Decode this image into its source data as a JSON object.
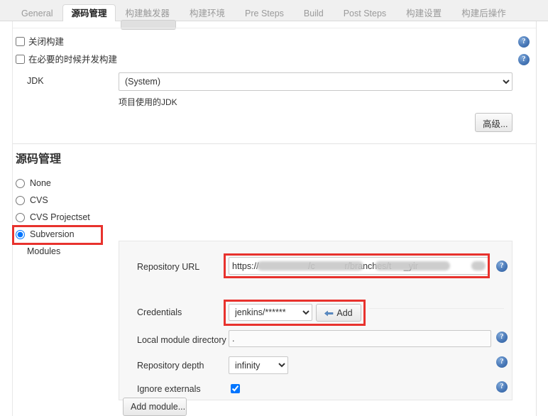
{
  "tabs": [
    {
      "label": "General",
      "active": false
    },
    {
      "label": "源码管理",
      "active": true
    },
    {
      "label": "构建触发器",
      "active": false
    },
    {
      "label": "构建环境",
      "active": false
    },
    {
      "label": "Pre Steps",
      "active": false
    },
    {
      "label": "Build",
      "active": false
    },
    {
      "label": "Post Steps",
      "active": false
    },
    {
      "label": "构建设置",
      "active": false
    },
    {
      "label": "构建后操作",
      "active": false
    }
  ],
  "general": {
    "disable_build_label": "关闭构建",
    "disable_build_checked": false,
    "concurrent_build_label": "在必要的时候并发构建",
    "concurrent_build_checked": false,
    "jdk_label": "JDK",
    "jdk_value": "(System)",
    "jdk_options": [
      "(System)"
    ],
    "jdk_help_text": "项目使用的JDK",
    "advanced_button": "高级..."
  },
  "scm": {
    "section_title": "源码管理",
    "options": [
      {
        "label": "None",
        "selected": false
      },
      {
        "label": "CVS",
        "selected": false
      },
      {
        "label": "CVS Projectset",
        "selected": false
      },
      {
        "label": "Subversion",
        "selected": true
      }
    ],
    "modules_label": "Modules",
    "fields": {
      "repository_url_label": "Repository URL",
      "repository_url_value": "https://                    /c            r/branches/t     _yir",
      "credentials_label": "Credentials",
      "credentials_value": "jenkins/******",
      "credentials_options": [
        "jenkins/******"
      ],
      "add_button": "Add",
      "local_module_dir_label": "Local module directory",
      "local_module_dir_value": ".",
      "repository_depth_label": "Repository depth",
      "repository_depth_value": "infinity",
      "repository_depth_options": [
        "infinity"
      ],
      "ignore_externals_label": "Ignore externals",
      "ignore_externals_checked": true
    },
    "add_module_button": "Add module..."
  },
  "icons": {
    "help": "?"
  },
  "colors": {
    "annotation_red": "#e8322d",
    "help_blue": "#4a79b8",
    "tab_active_text": "#1f1f1f",
    "tab_inactive_text": "#9a9a9a"
  }
}
